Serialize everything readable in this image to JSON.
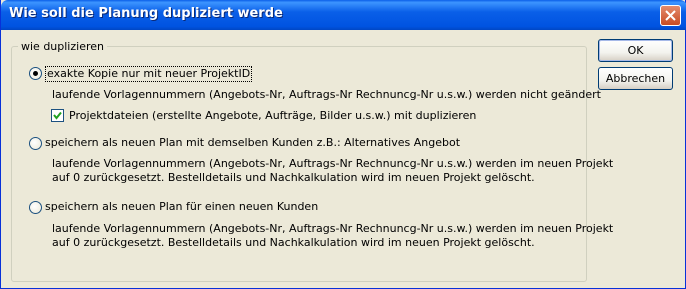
{
  "window": {
    "title": "Wie soll die Planung dupliziert werde"
  },
  "group": {
    "label": "wie duplizieren"
  },
  "options": [
    {
      "label": "exakte Kopie nur mit neuer ProjektID",
      "selected": true,
      "description_lines": [
        "laufende Vorlagennummern (Angebots-Nr, Auftrags-Nr Rechnuncg-Nr u.s.w.) werden nicht geändert"
      ]
    },
    {
      "label": "speichern als neuen Plan mit demselben Kunden z.B.: Alternatives Angebot",
      "selected": false,
      "description_lines": [
        "laufende Vorlagennummern (Angebots-Nr, Auftrags-Nr Rechnuncg-Nr u.s.w.) werden im neuen Projekt",
        "auf 0 zurückgesetzt. Bestelldetails und Nachkalkulation wird im neuen Projekt gelöscht."
      ]
    },
    {
      "label": "speichern als neuen Plan für einen neuen Kunden",
      "selected": false,
      "description_lines": [
        "laufende Vorlagennummern (Angebots-Nr, Auftrags-Nr Rechnuncg-Nr u.s.w.) werden im neuen Projekt",
        "auf 0 zurückgesetzt. Bestelldetails und Nachkalkulation wird im neuen Projekt gelöscht."
      ]
    }
  ],
  "checkbox": {
    "label": "Projektdateien (erstellte Angebote, Aufträge, Bilder u.s.w.) mit duplizieren",
    "checked": true
  },
  "buttons": {
    "ok": "OK",
    "cancel": "Abbrechen"
  },
  "colors": {
    "titlebar": "#0a5fe8",
    "dialog_bg": "#ece9d8",
    "close": "#c84b22"
  }
}
